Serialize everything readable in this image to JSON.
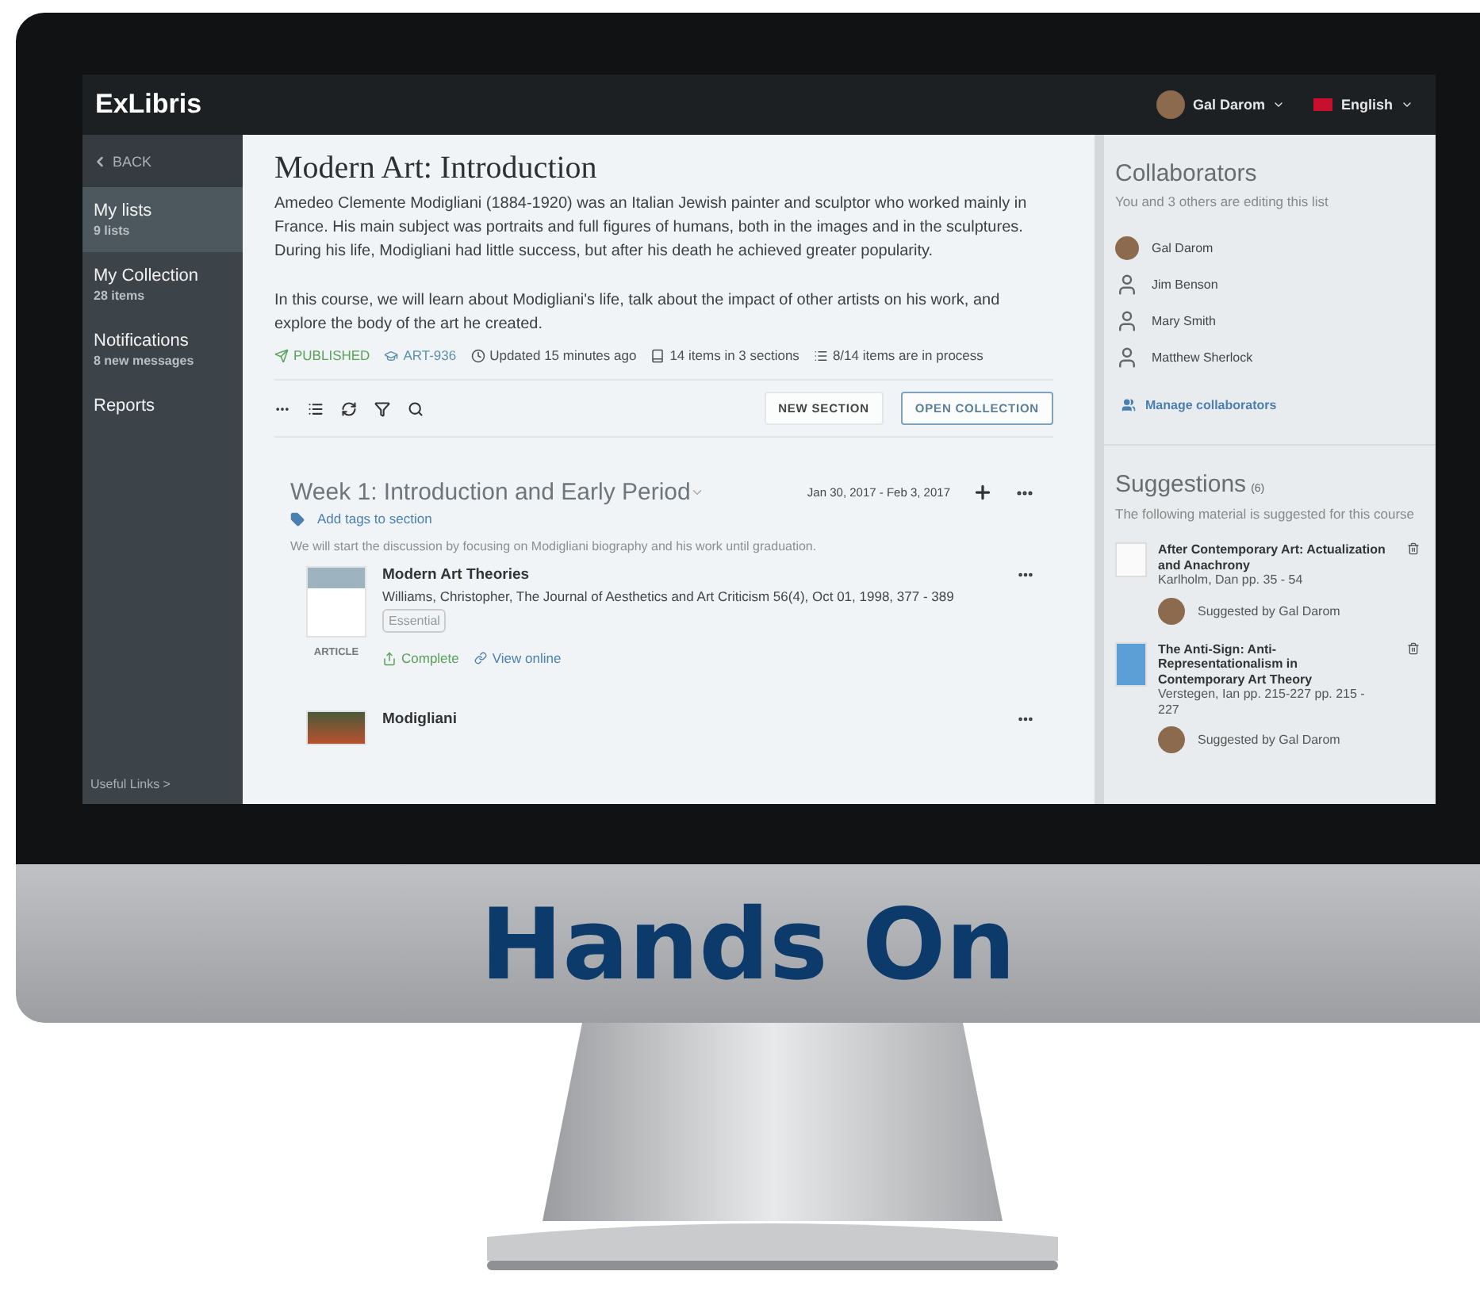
{
  "header": {
    "logo": "ExLibris",
    "user": "Gal Darom",
    "language": "English"
  },
  "sidebar": {
    "back": "BACK",
    "items": [
      {
        "label": "My lists",
        "sub": "9 lists",
        "selected": true
      },
      {
        "label": "My Collection",
        "sub": "28 items",
        "selected": false
      },
      {
        "label": "Notifications",
        "sub": "8 new messages",
        "selected": false
      },
      {
        "label": "Reports",
        "selected": false
      }
    ],
    "footer": "Useful Links >"
  },
  "main": {
    "title": "Modern Art: Introduction",
    "paragraphs": [
      "Amedeo Clemente Modigliani (1884-1920) was an Italian Jewish painter and sculptor who worked mainly in France. His main subject was portraits and full figures of humans, both in the images and in the sculptures. During his life, Modigliani had little success, but after his death he achieved greater popularity.",
      "In this course, we will learn about Modigliani's life, talk about the impact of other artists on his work, and explore the body of the art he created."
    ],
    "meta": [
      {
        "kind": "status",
        "text": "PUBLISHED"
      },
      {
        "kind": "code",
        "text": "ART-936"
      },
      {
        "kind": "updated",
        "text": "Updated 15 minutes ago"
      },
      {
        "kind": "items",
        "text": "14 items in 3 sections"
      },
      {
        "kind": "process",
        "text": "8/14 items are in process"
      }
    ],
    "buttons": [
      {
        "label": "NEW SECTION",
        "kind": "plain"
      },
      {
        "label": "OPEN COLLECTION",
        "kind": "outline"
      }
    ],
    "section": {
      "title": "Week 1: Introduction and Early Period",
      "dates": "Jan 30, 2017 - Feb 3, 2017",
      "tag_link": "Add tags to section",
      "description": "We will start the discussion by focusing on Modigliani biography and his work until graduation.",
      "items": [
        {
          "kind": "doc",
          "title": "Modern Art Theories",
          "citation": "Williams, Christopher, The Journal of Aesthetics and Art Criticism 56(4), Oct 01, 1998, 377 - 389",
          "tag": "Essential",
          "type": "ARTICLE",
          "status": "Complete",
          "link": "View online"
        },
        {
          "kind": "painting",
          "title": "Modigliani"
        }
      ]
    }
  },
  "collaborators": {
    "title": "Collaborators",
    "subtitle": "You and 3 others are editing this list",
    "people": [
      {
        "name": "Gal Darom",
        "kind": "photo"
      },
      {
        "name": "Jim Benson",
        "kind": "generic"
      },
      {
        "name": "Mary Smith",
        "kind": "generic"
      },
      {
        "name": "Matthew Sherlock",
        "kind": "generic"
      }
    ],
    "manage": "Manage collaborators"
  },
  "suggestions": {
    "title": "Suggestions",
    "count": "(6)",
    "subtitle": "The following material is suggested for this course",
    "items": [
      {
        "kind": "doc",
        "title": "After Contemporary Art: Actualization and Anachrony",
        "author": "Karlholm, Dan pp. 35 - 54",
        "suggested_by": "Suggested by Gal Darom"
      },
      {
        "kind": "cover",
        "title": "The Anti-Sign: Anti-Representationalism in Contemporary Art Theory",
        "author": "Verstegen, Ian pp. 215-227 pp. 215 - 227",
        "suggested_by": "Suggested by Gal Darom"
      }
    ]
  },
  "banner": "Hands On"
}
